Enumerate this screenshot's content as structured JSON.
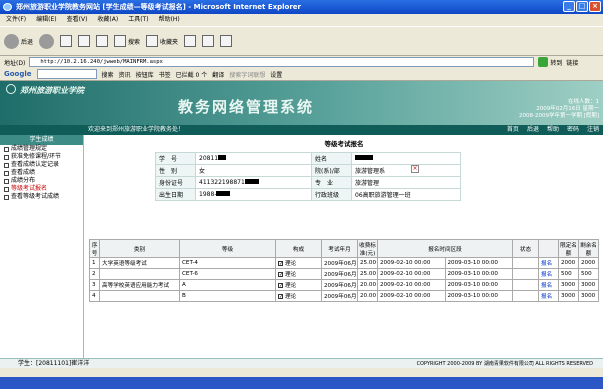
{
  "window": {
    "title": "郑州旅游职业学院教务网站 [学生成绩—等级考试报名] - Microsoft Internet Explorer",
    "min": "_",
    "max": "□",
    "close": "×"
  },
  "menu": [
    "文件(F)",
    "编辑(E)",
    "查看(V)",
    "收藏(A)",
    "工具(T)",
    "帮助(H)"
  ],
  "toolbar": {
    "back": "后退",
    "search": "搜索",
    "favorites": "收藏夹"
  },
  "address": {
    "label": "地址(D)",
    "url": "http://10.2.16.240/jwweb/MAINFRM.aspx",
    "go": "转到",
    "links": "链接"
  },
  "google": {
    "logo": "Google",
    "search": "搜索",
    "news": "资讯",
    "toolbox": "按钮库",
    "bookmarks": "书签",
    "blocked": "已拦截 0 个",
    "translate": "翻译",
    "hint": "搜索字词联想",
    "settings": "设置"
  },
  "banner": {
    "school": "郑州旅游职业学院",
    "system": "教务网络管理系统",
    "online": "在线人数：1",
    "date": "2009年02月16日 星期一",
    "term": "2008-2009学年第一学期 [假期]"
  },
  "subbar": {
    "welcome": "欢迎来到郑州旅游职业学院教务处！",
    "nav": [
      "首页",
      "后退",
      "帮助",
      "密码",
      "注销"
    ]
  },
  "sidebar": {
    "head": "学生成绩",
    "items": [
      "成绩管理规定",
      "获准免修课程/环节",
      "查看成绩认定记录",
      "查看成绩",
      "成绩分布",
      "等级考试报名",
      "查看等级考试成绩"
    ],
    "active": 5
  },
  "page": {
    "title": "等级考试报名"
  },
  "student": {
    "labels": {
      "id": "学　号",
      "name": "姓名",
      "gender": "性　别",
      "dept": "院(系)/部",
      "idcard": "身份证号",
      "major": "专　业",
      "birth": "出生日期",
      "class": "行政班级"
    },
    "values": {
      "id": "20811",
      "gender": "女",
      "dept": "旅游管理系",
      "idcard": "411322198871",
      "major": "旅游管理",
      "birth": "1988-",
      "class": "06高职旅游管理一班"
    }
  },
  "grid": {
    "headers": [
      "序号",
      "类别",
      "等级",
      "构成",
      "考试年月",
      "收费标准(元)",
      "报名时间区段",
      "状态",
      "",
      "限定名额",
      "剩余名额"
    ],
    "rows": [
      [
        "1",
        "大学英语等级考试",
        "CET-4",
        "理论",
        "2009年06月",
        "25.00",
        "2009-02-10 00:00",
        "2009-03-10 00:00",
        "",
        "报名",
        "2000",
        "2000"
      ],
      [
        "2",
        "",
        "CET-6",
        "理论",
        "2009年06月",
        "25.00",
        "2009-02-10 00:00",
        "2009-03-10 00:00",
        "",
        "报名",
        "500",
        "500"
      ],
      [
        "3",
        "高等学校英语应用能力考试",
        "A",
        "理论",
        "2009年06月",
        "20.00",
        "2009-02-10 00:00",
        "2009-03-10 00:00",
        "",
        "报名",
        "3000",
        "3000"
      ],
      [
        "4",
        "",
        "B",
        "理论",
        "2009年06月",
        "20.00",
        "2009-02-10 00:00",
        "2009-03-10 00:00",
        "",
        "报名",
        "3000",
        "3000"
      ]
    ]
  },
  "footer": {
    "status": "学生：[20811101]崔洋洋",
    "copyright": "COPYRIGHT 2000-2009 BY 湖南青果软件有限公司 ALL RIGHTS RESERVED"
  }
}
